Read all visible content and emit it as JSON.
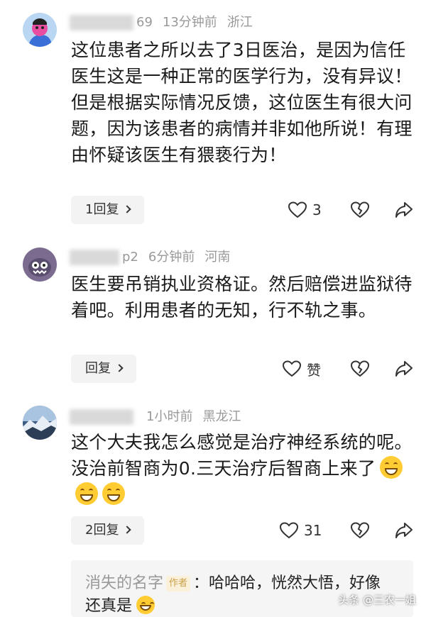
{
  "comments": [
    {
      "username_tail": "69",
      "time": "13分钟前",
      "location": "浙江",
      "text": "这位患者之所以去了3日医治，是因为信任医生这是一种正常的医学行为，没有异议！但是根据实际情况反馈，这位医生有很大问题，因为该患者的病情并非如他所说！有理由怀疑该医生有猥亵行为！",
      "reply_label": "1回复",
      "like_count": "3"
    },
    {
      "username_tail": "p2",
      "time": "6分钟前",
      "location": "河南",
      "text": "医生要吊销执业资格证。然后赔偿进监狱待着吧。利用患者的无知，行不轨之事。",
      "reply_label": "回复",
      "like_label": "赞"
    },
    {
      "username_tail": "",
      "time": "1小时前",
      "location": "黑龙江",
      "text": "这个大夫我怎么感觉是治疗神经系统的呢。没治前智商为0.三天治疗后智商上来了",
      "reply_label": "2回复",
      "like_count": "31",
      "emojis": [
        "grin-emoji",
        "grin-emoji",
        "grin-emoji"
      ]
    }
  ],
  "sub_reply": {
    "name": "消失的名字",
    "author_tag": "作者",
    "text_line1": "：哈哈哈，恍然大悟，好像",
    "text_line2": "还真是"
  },
  "watermark": "头条 @三农一姐",
  "colors": {
    "meta_gray": "#999999",
    "author_tag": "#c9a04a",
    "bg": "#ffffff",
    "sub_bg": "#f5f5f5"
  }
}
